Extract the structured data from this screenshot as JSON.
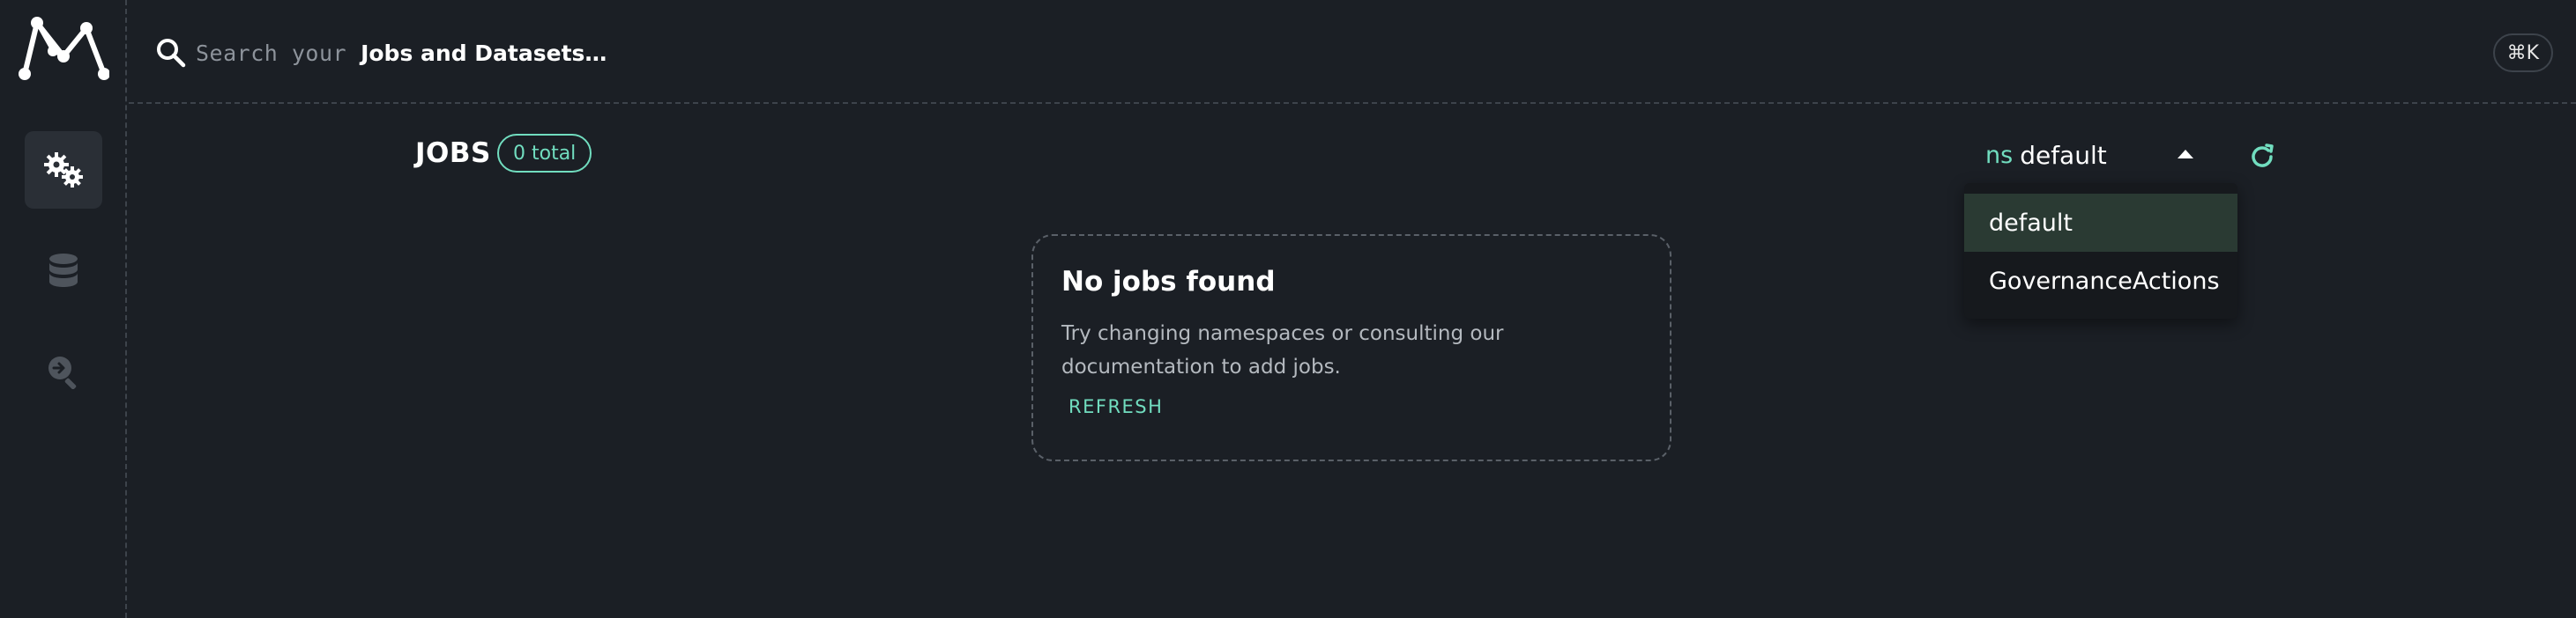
{
  "header": {
    "search_placeholder": "Search your",
    "search_emphasis": "Jobs and Datasets…",
    "shortcut": "⌘K"
  },
  "sidebar": {
    "items": [
      {
        "icon": "gears-icon",
        "label": "Jobs",
        "active": true
      },
      {
        "icon": "database-icon",
        "label": "Datasets",
        "active": false
      },
      {
        "icon": "search-arrow-icon",
        "label": "Lineage",
        "active": false
      }
    ]
  },
  "jobs": {
    "title": "JOBS",
    "total_chip": "0 total"
  },
  "namespace": {
    "prefix": "ns",
    "value": "default",
    "options": [
      "default",
      "GovernanceActions"
    ],
    "selected_index": 0
  },
  "empty_state": {
    "title": "No jobs found",
    "description": "Try changing namespaces or consulting our documentation to add jobs.",
    "action_label": "REFRESH"
  },
  "colors": {
    "background": "#1b1f25",
    "accent": "#71ddbf",
    "dropdown_bg": "#16191d",
    "selected_bg": "#2a3a33"
  }
}
